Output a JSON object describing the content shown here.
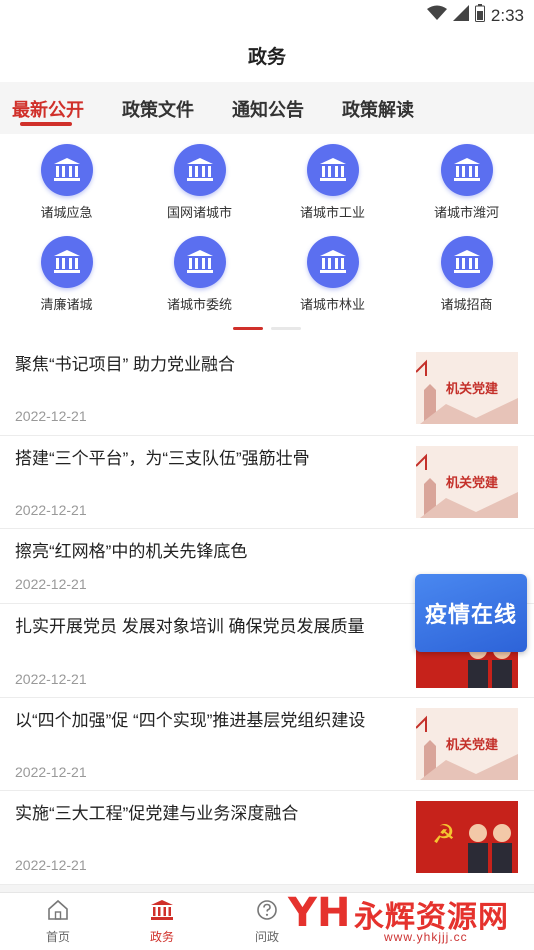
{
  "status_bar": {
    "time": "2:33"
  },
  "header": {
    "title": "政务"
  },
  "tabs": [
    {
      "label": "最新公开",
      "active": true
    },
    {
      "label": "政策文件",
      "active": false
    },
    {
      "label": "通知公告",
      "active": false
    },
    {
      "label": "政策解读",
      "active": false
    }
  ],
  "grid": {
    "icon": "government-building-icon",
    "accent": "#5b6ff0",
    "items": [
      {
        "label": "诸城应急"
      },
      {
        "label": "国网诸城市"
      },
      {
        "label": "诸城市工业"
      },
      {
        "label": "诸城市潍河"
      },
      {
        "label": "清廉诸城"
      },
      {
        "label": "诸城市委统"
      },
      {
        "label": "诸城市林业"
      },
      {
        "label": "诸城招商"
      }
    ]
  },
  "news": [
    {
      "title": "聚焦“书记项目” 助力党业融合",
      "date": "2022-12-21",
      "thumb_text": "机关党建"
    },
    {
      "title": "搭建“三个平台”，为“三支队伍”强筋壮骨",
      "date": "2022-12-21",
      "thumb_text": "机关党建"
    },
    {
      "title": "擦亮“红网格”中的机关先锋底色",
      "date": "2022-12-21"
    },
    {
      "title": "扎实开展党员 发展对象培训 确保党员发展质量",
      "date": "2022-12-21"
    },
    {
      "title": "以“四个加强”促 “四个实现”推进基层党组织建设",
      "date": "2022-12-21",
      "thumb_text": "机关党建"
    },
    {
      "title": "实施“三大工程”促党建与业务深度融合",
      "date": "2022-12-21"
    }
  ],
  "floating_badge": {
    "label": "疫情在线"
  },
  "bottom_nav": [
    {
      "label": "首页",
      "icon": "home-icon",
      "active": false
    },
    {
      "label": "政务",
      "icon": "government-building-icon",
      "active": true
    },
    {
      "label": "问政",
      "icon": "question-icon",
      "active": false
    }
  ],
  "watermark": {
    "title": "永辉资源网",
    "url": "www.yhkjjj.cc"
  },
  "colors": {
    "accent_red": "#d0302a",
    "icon_blue": "#5b6ff0"
  }
}
